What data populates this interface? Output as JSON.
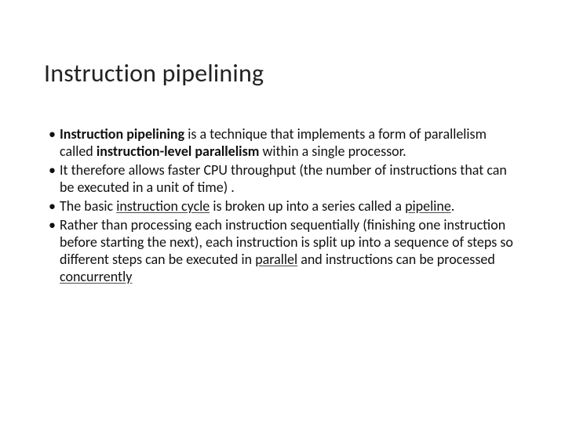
{
  "title": "Instruction pipelining",
  "bullets": [
    {
      "parts": [
        {
          "t": "Instruction pipelining",
          "b": true
        },
        {
          "t": " is a technique that implements a form of parallelism called "
        },
        {
          "t": "instruction-level parallelism",
          "b": true
        },
        {
          "t": " within a single processor."
        }
      ]
    },
    {
      "parts": [
        {
          "t": "It therefore allows faster CPU throughput (the number of instructions that can be executed in a unit of time) ."
        }
      ]
    },
    {
      "parts": [
        {
          "t": "The basic "
        },
        {
          "t": "instruction cycle",
          "u": true
        },
        {
          "t": " is broken up into a series called a "
        },
        {
          "t": "pipeline",
          "u": true
        },
        {
          "t": "."
        }
      ]
    },
    {
      "parts": [
        {
          "t": "Rather than processing each instruction sequentially (finishing one instruction before starting the next), each instruction is split up into a sequence of steps so different steps can be executed in "
        },
        {
          "t": "parallel",
          "u": true
        },
        {
          "t": " and instructions can be processed "
        },
        {
          "t": "concurrently",
          "u": true
        }
      ]
    }
  ]
}
